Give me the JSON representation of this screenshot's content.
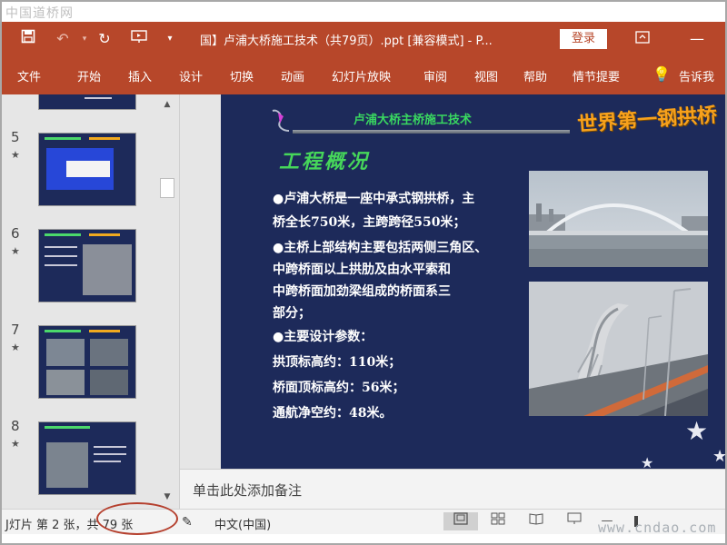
{
  "watermark_top": "中国道桥网",
  "watermark_bottom": "www.cndao.com",
  "titlebar": {
    "title": "国】卢浦大桥施工技术（共79页）.ppt [兼容模式] - P...",
    "login_label": "登录"
  },
  "ribbon": {
    "tabs": [
      "文件",
      "开始",
      "插入",
      "设计",
      "切换",
      "动画",
      "幻灯片放映",
      "审阅",
      "视图",
      "帮助",
      "情节提要",
      "告诉我"
    ]
  },
  "thumbnails": [
    {
      "number": "5",
      "star": "★"
    },
    {
      "number": "6",
      "star": "★"
    },
    {
      "number": "7",
      "star": "★"
    },
    {
      "number": "8",
      "star": "★"
    }
  ],
  "slide": {
    "header": "卢浦大桥主桥施工技术",
    "big_title": "世界第一钢拱桥",
    "section_title": "工程概况",
    "lines": [
      "●卢浦大桥是一座中承式钢拱桥，主",
      "   桥全长750米，主跨跨径550米；",
      "●主桥上部结构主要包括两侧三角区、",
      "   中跨桥面以上拱肋及由水平索和",
      "   中跨桥面加劲梁组成的桥面系三",
      "   部分；",
      "●主要设计参数：",
      "  拱顶标高约：110米；",
      "  桥面顶标高约：56米；",
      "  通航净空约：48米。"
    ]
  },
  "notes": {
    "placeholder": "单击此处添加备注"
  },
  "statusbar": {
    "slide_info": "J灯片 第 2 张，共 79 张",
    "language": "中文(中国)"
  },
  "colors": {
    "accent": "#b7472a",
    "slide_bg": "#1d2a5a",
    "slide_title_green": "#46d65a",
    "slide_banner_orange": "#f7a11c"
  }
}
